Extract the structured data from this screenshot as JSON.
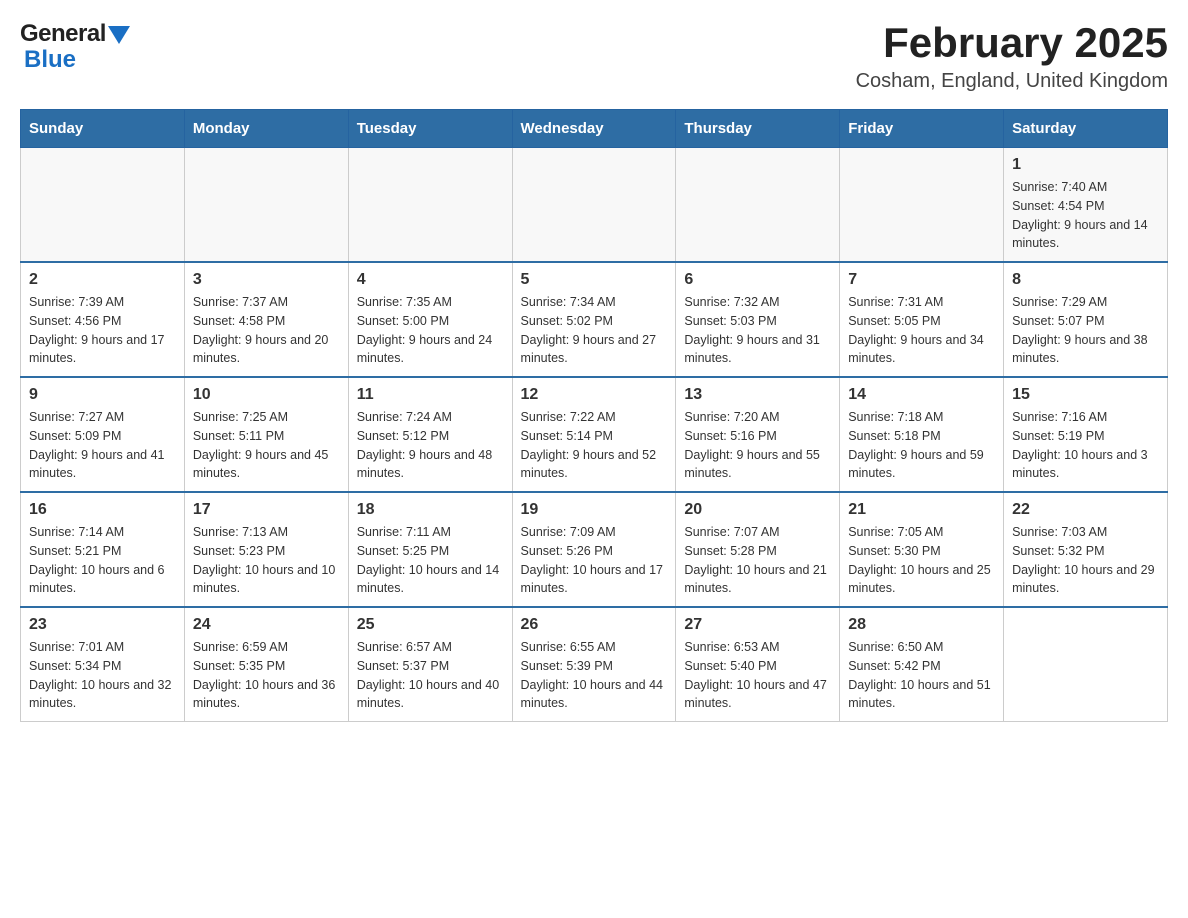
{
  "logo": {
    "general": "General",
    "blue": "Blue"
  },
  "title": "February 2025",
  "subtitle": "Cosham, England, United Kingdom",
  "weekdays": [
    "Sunday",
    "Monday",
    "Tuesday",
    "Wednesday",
    "Thursday",
    "Friday",
    "Saturday"
  ],
  "weeks": [
    [
      {
        "day": "",
        "info": ""
      },
      {
        "day": "",
        "info": ""
      },
      {
        "day": "",
        "info": ""
      },
      {
        "day": "",
        "info": ""
      },
      {
        "day": "",
        "info": ""
      },
      {
        "day": "",
        "info": ""
      },
      {
        "day": "1",
        "info": "Sunrise: 7:40 AM\nSunset: 4:54 PM\nDaylight: 9 hours and 14 minutes."
      }
    ],
    [
      {
        "day": "2",
        "info": "Sunrise: 7:39 AM\nSunset: 4:56 PM\nDaylight: 9 hours and 17 minutes."
      },
      {
        "day": "3",
        "info": "Sunrise: 7:37 AM\nSunset: 4:58 PM\nDaylight: 9 hours and 20 minutes."
      },
      {
        "day": "4",
        "info": "Sunrise: 7:35 AM\nSunset: 5:00 PM\nDaylight: 9 hours and 24 minutes."
      },
      {
        "day": "5",
        "info": "Sunrise: 7:34 AM\nSunset: 5:02 PM\nDaylight: 9 hours and 27 minutes."
      },
      {
        "day": "6",
        "info": "Sunrise: 7:32 AM\nSunset: 5:03 PM\nDaylight: 9 hours and 31 minutes."
      },
      {
        "day": "7",
        "info": "Sunrise: 7:31 AM\nSunset: 5:05 PM\nDaylight: 9 hours and 34 minutes."
      },
      {
        "day": "8",
        "info": "Sunrise: 7:29 AM\nSunset: 5:07 PM\nDaylight: 9 hours and 38 minutes."
      }
    ],
    [
      {
        "day": "9",
        "info": "Sunrise: 7:27 AM\nSunset: 5:09 PM\nDaylight: 9 hours and 41 minutes."
      },
      {
        "day": "10",
        "info": "Sunrise: 7:25 AM\nSunset: 5:11 PM\nDaylight: 9 hours and 45 minutes."
      },
      {
        "day": "11",
        "info": "Sunrise: 7:24 AM\nSunset: 5:12 PM\nDaylight: 9 hours and 48 minutes."
      },
      {
        "day": "12",
        "info": "Sunrise: 7:22 AM\nSunset: 5:14 PM\nDaylight: 9 hours and 52 minutes."
      },
      {
        "day": "13",
        "info": "Sunrise: 7:20 AM\nSunset: 5:16 PM\nDaylight: 9 hours and 55 minutes."
      },
      {
        "day": "14",
        "info": "Sunrise: 7:18 AM\nSunset: 5:18 PM\nDaylight: 9 hours and 59 minutes."
      },
      {
        "day": "15",
        "info": "Sunrise: 7:16 AM\nSunset: 5:19 PM\nDaylight: 10 hours and 3 minutes."
      }
    ],
    [
      {
        "day": "16",
        "info": "Sunrise: 7:14 AM\nSunset: 5:21 PM\nDaylight: 10 hours and 6 minutes."
      },
      {
        "day": "17",
        "info": "Sunrise: 7:13 AM\nSunset: 5:23 PM\nDaylight: 10 hours and 10 minutes."
      },
      {
        "day": "18",
        "info": "Sunrise: 7:11 AM\nSunset: 5:25 PM\nDaylight: 10 hours and 14 minutes."
      },
      {
        "day": "19",
        "info": "Sunrise: 7:09 AM\nSunset: 5:26 PM\nDaylight: 10 hours and 17 minutes."
      },
      {
        "day": "20",
        "info": "Sunrise: 7:07 AM\nSunset: 5:28 PM\nDaylight: 10 hours and 21 minutes."
      },
      {
        "day": "21",
        "info": "Sunrise: 7:05 AM\nSunset: 5:30 PM\nDaylight: 10 hours and 25 minutes."
      },
      {
        "day": "22",
        "info": "Sunrise: 7:03 AM\nSunset: 5:32 PM\nDaylight: 10 hours and 29 minutes."
      }
    ],
    [
      {
        "day": "23",
        "info": "Sunrise: 7:01 AM\nSunset: 5:34 PM\nDaylight: 10 hours and 32 minutes."
      },
      {
        "day": "24",
        "info": "Sunrise: 6:59 AM\nSunset: 5:35 PM\nDaylight: 10 hours and 36 minutes."
      },
      {
        "day": "25",
        "info": "Sunrise: 6:57 AM\nSunset: 5:37 PM\nDaylight: 10 hours and 40 minutes."
      },
      {
        "day": "26",
        "info": "Sunrise: 6:55 AM\nSunset: 5:39 PM\nDaylight: 10 hours and 44 minutes."
      },
      {
        "day": "27",
        "info": "Sunrise: 6:53 AM\nSunset: 5:40 PM\nDaylight: 10 hours and 47 minutes."
      },
      {
        "day": "28",
        "info": "Sunrise: 6:50 AM\nSunset: 5:42 PM\nDaylight: 10 hours and 51 minutes."
      },
      {
        "day": "",
        "info": ""
      }
    ]
  ]
}
